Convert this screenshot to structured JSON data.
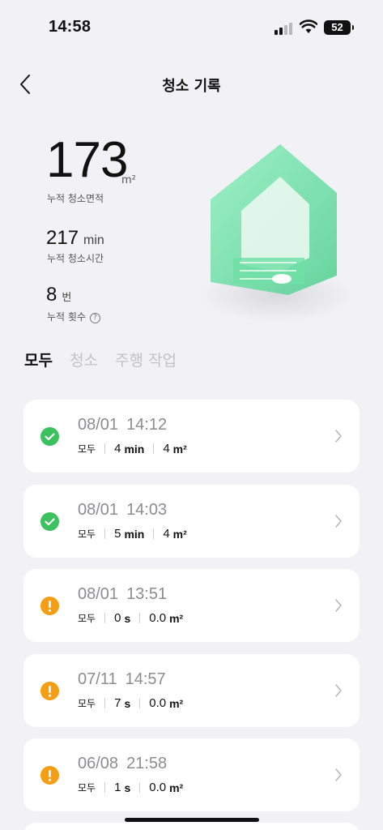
{
  "status_bar": {
    "time": "14:58",
    "battery": "52"
  },
  "nav": {
    "title": "청소 기록"
  },
  "stats": {
    "area_value": "173",
    "area_unit": "m²",
    "area_label": "누적 청소면적",
    "time_value": "217",
    "time_unit": "min",
    "time_label": "누적 청소시간",
    "count_value": "8",
    "count_unit": "번",
    "count_label": "누적 횟수",
    "help_glyph": "?"
  },
  "tabs": [
    {
      "label": "모두",
      "active": true
    },
    {
      "label": "청소",
      "active": false
    },
    {
      "label": "주행 작업",
      "active": false
    }
  ],
  "records": [
    {
      "date": "08/01",
      "time": "14:12",
      "mode": "모두",
      "duration_num": "4",
      "duration_unit": "min",
      "area_num": "4",
      "area_unit": "m²",
      "status": "success"
    },
    {
      "date": "08/01",
      "time": "14:03",
      "mode": "모두",
      "duration_num": "5",
      "duration_unit": "min",
      "area_num": "4",
      "area_unit": "m²",
      "status": "success"
    },
    {
      "date": "08/01",
      "time": "13:51",
      "mode": "모두",
      "duration_num": "0",
      "duration_unit": "s",
      "area_num": "0.0",
      "area_unit": "m²",
      "status": "warning"
    },
    {
      "date": "07/11",
      "time": "14:57",
      "mode": "모두",
      "duration_num": "7",
      "duration_unit": "s",
      "area_num": "0.0",
      "area_unit": "m²",
      "status": "warning"
    },
    {
      "date": "06/08",
      "time": "21:58",
      "mode": "모두",
      "duration_num": "1",
      "duration_unit": "s",
      "area_num": "0.0",
      "area_unit": "m²",
      "status": "warning"
    }
  ],
  "icons": {
    "back": "back-chevron-icon",
    "success": "check-circle-icon",
    "warning": "exclamation-circle-icon",
    "chevron": "chevron-right-icon"
  },
  "colors": {
    "success": "#3bc25f",
    "warning": "#f59d13",
    "background": "#f2f1f6",
    "accent_house": "#6fe0a6"
  }
}
